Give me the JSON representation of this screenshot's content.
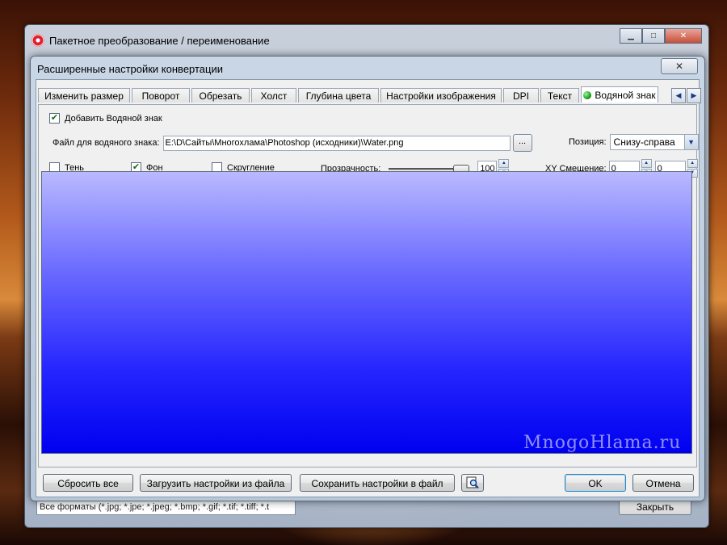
{
  "outer_window": {
    "title": "Пакетное преобразование / переименование",
    "format_select": "Все форматы (*.jpg; *.jpe; *.jpeg; *.bmp; *.gif; *.tif; *.tiff; *.t",
    "close_button": "Закрыть",
    "minimize_glyph": "▁",
    "maximize_glyph": "□",
    "close_glyph": "✕"
  },
  "dialog": {
    "title": "Расширенные настройки конвертации",
    "close_glyph": "✕",
    "tabs": [
      {
        "label": "Изменить размер"
      },
      {
        "label": "Поворот"
      },
      {
        "label": "Обрезать"
      },
      {
        "label": "Холст"
      },
      {
        "label": "Глубина цвета"
      },
      {
        "label": "Настройки изображения"
      },
      {
        "label": "DPI"
      },
      {
        "label": "Текст"
      },
      {
        "label": "Водяной знак"
      }
    ],
    "tab_scroll_left": "◀",
    "tab_scroll_right": "▶",
    "watermark_tab": {
      "add_watermark_label": "Добавить Водяной знак",
      "add_watermark_checked": true,
      "file_label": "Файл для водяного знака:",
      "file_path": "E:\\D\\Сайты\\Многохлама\\Photoshop (исходники)\\Water.png",
      "browse_label": "...",
      "position_label": "Позиция:",
      "position_value": "Снизу-справа",
      "shadow_label": "Тень",
      "shadow_checked": false,
      "background_label": "Фон",
      "background_checked": true,
      "rounding_label": "Скругление",
      "rounding_checked": false,
      "opacity_label": "Прозрачность:",
      "opacity_value": "100",
      "xy_offset_label": "XY Смещение:",
      "x_offset": "0",
      "y_offset": "0"
    },
    "buttons": {
      "reset_all": "Сбросить все",
      "load_settings": "Загрузить настройки из файла",
      "save_settings": "Сохранить настройки в файл",
      "ok": "OK",
      "cancel": "Отмена"
    },
    "check_mark": "✔",
    "spin_up": "▲",
    "spin_down": "▼",
    "select_arrow": "▼"
  },
  "watermark_overlay": "MnogoHlama.ru",
  "colors": {
    "preview_top": "#b9b9ff",
    "preview_bottom": "#0000f0",
    "accent": "#3c7fb1"
  }
}
